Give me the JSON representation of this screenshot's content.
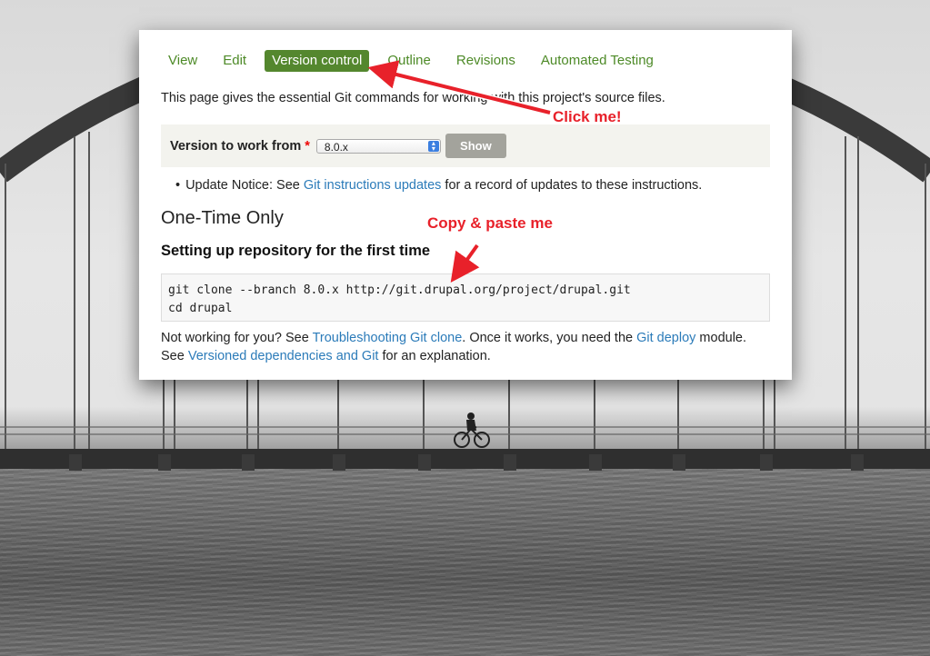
{
  "tabs": [
    {
      "label": "View",
      "active": false
    },
    {
      "label": "Edit",
      "active": false
    },
    {
      "label": "Version control",
      "active": true
    },
    {
      "label": "Outline",
      "active": false
    },
    {
      "label": "Revisions",
      "active": false
    },
    {
      "label": "Automated Testing",
      "active": false
    }
  ],
  "intro": "This page gives the essential Git commands for working with this project's source files.",
  "version": {
    "label": "Version to work from",
    "required_mark": "*",
    "selected": "8.0.x",
    "show_button": "Show"
  },
  "notice": {
    "prefix": "Update Notice: See ",
    "link": "Git instructions updates",
    "suffix": " for a record of updates to these instructions."
  },
  "section_title": "One-Time Only",
  "subsection_title": "Setting up repository for the first time",
  "code_lines": [
    "git clone --branch 8.0.x http://git.drupal.org/project/drupal.git",
    "cd drupal"
  ],
  "footer": {
    "t1": "Not working for you? See ",
    "link1": "Troubleshooting Git clone",
    "t2": ". Once it works, you need the ",
    "link2": "Git deploy",
    "t3": " module. See ",
    "link3": "Versioned dependencies and Git",
    "t4": " for an explanation."
  },
  "annotations": {
    "click_me": "Click me!",
    "copy_paste": "Copy & paste me"
  },
  "colors": {
    "tab_green": "#4d8a27",
    "active_tab_bg": "#54872e",
    "link_blue": "#2b7bb9",
    "annotation_red": "#e8212a"
  }
}
